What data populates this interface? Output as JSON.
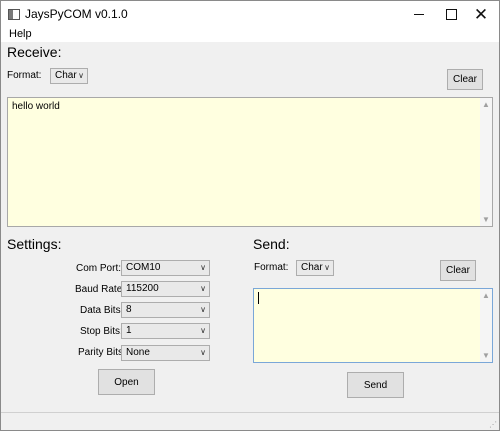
{
  "window": {
    "title": "JaysPyCOM v0.1.0",
    "controls": {
      "minimize": "—",
      "maximize": "☐",
      "close": "✕"
    }
  },
  "menu": {
    "help": "Help"
  },
  "receive": {
    "title": "Receive:",
    "format_label": "Format:",
    "format_value": "Char",
    "clear_label": "Clear",
    "text": "hello world"
  },
  "settings": {
    "title": "Settings:",
    "com_port_label": "Com Port:",
    "com_port_value": "COM10",
    "baud_rate_label": "Baud Rate:",
    "baud_rate_value": "115200",
    "data_bits_label": "Data Bits:",
    "data_bits_value": "8",
    "stop_bits_label": "Stop Bits:",
    "stop_bits_value": "1",
    "parity_bits_label": "Parity Bits",
    "parity_bits_value": "None",
    "open_label": "Open"
  },
  "send": {
    "title": "Send:",
    "format_label": "Format:",
    "format_value": "Char",
    "clear_label": "Clear",
    "text": "",
    "send_label": "Send"
  },
  "icons": {
    "dropdown": "∨",
    "scroll_up": "▲",
    "scroll_down": "▼",
    "resize_grip": "⋰"
  }
}
